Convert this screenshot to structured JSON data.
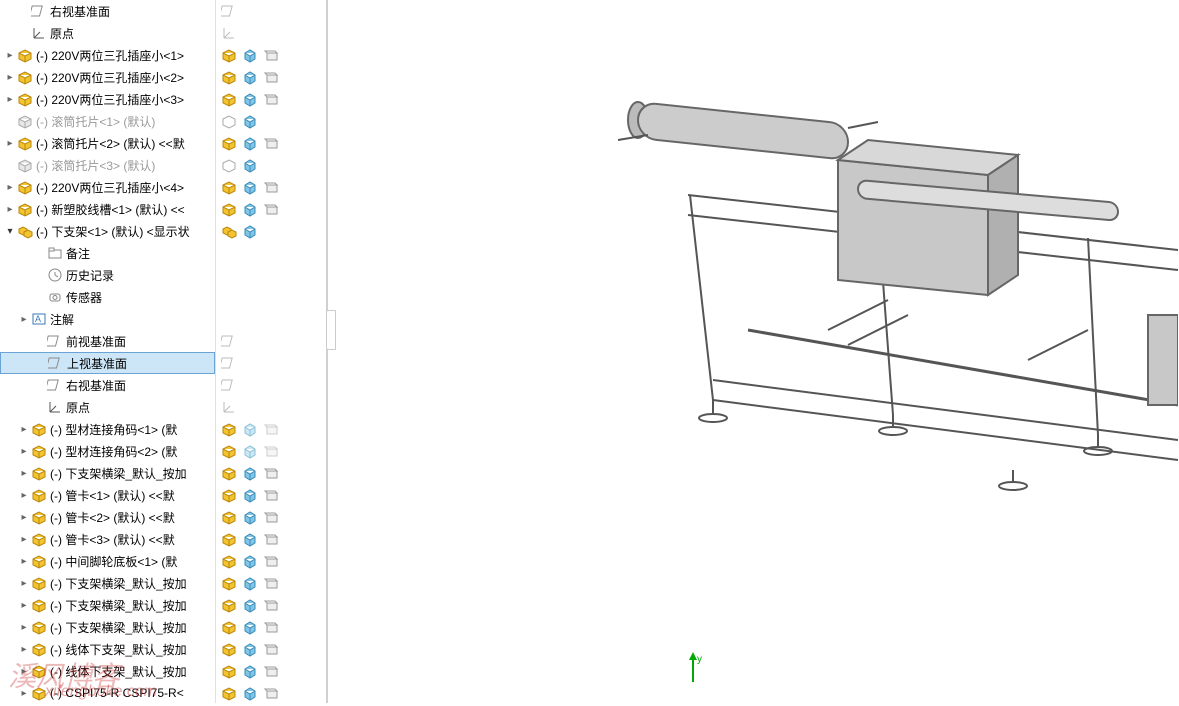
{
  "tree": {
    "items": [
      {
        "indent": 1,
        "arrow": "",
        "icon": "plane",
        "label": "右视基准面",
        "gray": false
      },
      {
        "indent": 1,
        "arrow": "",
        "icon": "origin",
        "label": "原点",
        "gray": false
      },
      {
        "indent": 0,
        "arrow": "r",
        "icon": "part",
        "label": "(-) 220V两位三孔插座小<1>",
        "gray": false
      },
      {
        "indent": 0,
        "arrow": "r",
        "icon": "part",
        "label": "(-) 220V两位三孔插座小<2>",
        "gray": false
      },
      {
        "indent": 0,
        "arrow": "r",
        "icon": "part",
        "label": "(-) 220V两位三孔插座小<3>",
        "gray": false
      },
      {
        "indent": 0,
        "arrow": "",
        "icon": "part-g",
        "label": "(-) 滚筒托片<1> (默认)",
        "gray": true
      },
      {
        "indent": 0,
        "arrow": "r",
        "icon": "part",
        "label": "(-) 滚筒托片<2> (默认) <<默",
        "gray": false
      },
      {
        "indent": 0,
        "arrow": "",
        "icon": "part-g",
        "label": "(-) 滚筒托片<3> (默认)",
        "gray": true
      },
      {
        "indent": 0,
        "arrow": "r",
        "icon": "part",
        "label": "(-) 220V两位三孔插座小<4>",
        "gray": false
      },
      {
        "indent": 0,
        "arrow": "r",
        "icon": "part",
        "label": "(-) 新塑胶线槽<1> (默认) <<",
        "gray": false
      },
      {
        "indent": 0,
        "arrow": "d",
        "icon": "asm",
        "label": "(-) 下支架<1> (默认) <显示状",
        "gray": false
      },
      {
        "indent": 2,
        "arrow": "",
        "icon": "folder",
        "label": "备注",
        "gray": false
      },
      {
        "indent": 2,
        "arrow": "",
        "icon": "history",
        "label": "历史记录",
        "gray": false
      },
      {
        "indent": 2,
        "arrow": "",
        "icon": "sensor",
        "label": "传感器",
        "gray": false
      },
      {
        "indent": 1,
        "arrow": "r",
        "icon": "annot",
        "label": "注解",
        "gray": false
      },
      {
        "indent": 2,
        "arrow": "",
        "icon": "plane",
        "label": "前视基准面",
        "gray": false
      },
      {
        "indent": 2,
        "arrow": "",
        "icon": "plane",
        "label": "上视基准面",
        "gray": false,
        "selected": true
      },
      {
        "indent": 2,
        "arrow": "",
        "icon": "plane",
        "label": "右视基准面",
        "gray": false
      },
      {
        "indent": 2,
        "arrow": "",
        "icon": "origin",
        "label": "原点",
        "gray": false
      },
      {
        "indent": 1,
        "arrow": "r",
        "icon": "part",
        "label": "(-) 型材连接角码<1> (默",
        "gray": false
      },
      {
        "indent": 1,
        "arrow": "r",
        "icon": "part",
        "label": "(-) 型材连接角码<2> (默",
        "gray": false
      },
      {
        "indent": 1,
        "arrow": "r",
        "icon": "part",
        "label": "(-) 下支架横梁_默认_按加",
        "gray": false
      },
      {
        "indent": 1,
        "arrow": "r",
        "icon": "part",
        "label": "(-) 管卡<1> (默认) <<默",
        "gray": false
      },
      {
        "indent": 1,
        "arrow": "r",
        "icon": "part",
        "label": "(-) 管卡<2> (默认) <<默",
        "gray": false
      },
      {
        "indent": 1,
        "arrow": "r",
        "icon": "part",
        "label": "(-) 管卡<3> (默认) <<默",
        "gray": false
      },
      {
        "indent": 1,
        "arrow": "r",
        "icon": "part",
        "label": "(-) 中间脚轮底板<1> (默",
        "gray": false
      },
      {
        "indent": 1,
        "arrow": "r",
        "icon": "part",
        "label": "(-) 下支架横梁_默认_按加",
        "gray": false
      },
      {
        "indent": 1,
        "arrow": "r",
        "icon": "part",
        "label": "(-) 下支架横梁_默认_按加",
        "gray": false
      },
      {
        "indent": 1,
        "arrow": "r",
        "icon": "part",
        "label": "(-) 下支架横梁_默认_按加",
        "gray": false
      },
      {
        "indent": 1,
        "arrow": "r",
        "icon": "part",
        "label": "(-) 线体下支架_默认_按加",
        "gray": false
      },
      {
        "indent": 1,
        "arrow": "r",
        "icon": "part",
        "label": "(-) 线体下支架_默认_按加",
        "gray": false
      },
      {
        "indent": 1,
        "arrow": "r",
        "icon": "part",
        "label": "(-) CSPI75-R CSPI75-R<",
        "gray": false
      }
    ]
  },
  "iconCol": {
    "rows": [
      [
        "plane-g"
      ],
      [
        "origin-g"
      ],
      [
        "part",
        "cube",
        "sheet"
      ],
      [
        "part",
        "cube",
        "sheet"
      ],
      [
        "part",
        "cube",
        "sheet"
      ],
      [
        "part-gl",
        "cube"
      ],
      [
        "part",
        "cube",
        "sheet"
      ],
      [
        "part-gl",
        "cube"
      ],
      [
        "part",
        "cube",
        "sheet"
      ],
      [
        "part",
        "cube",
        "sheet"
      ],
      [
        "asm",
        "cube"
      ],
      [],
      [],
      [],
      [],
      [
        "plane-g"
      ],
      [
        "plane-g"
      ],
      [
        "plane-g"
      ],
      [
        "origin-g"
      ],
      [
        "part",
        "cube-t",
        "sheet-t"
      ],
      [
        "part",
        "cube-t",
        "sheet-t"
      ],
      [
        "part",
        "cube",
        "sheet"
      ],
      [
        "part",
        "cube",
        "sheet"
      ],
      [
        "part",
        "cube",
        "sheet"
      ],
      [
        "part",
        "cube",
        "sheet"
      ],
      [
        "part",
        "cube",
        "sheet"
      ],
      [
        "part",
        "cube",
        "sheet"
      ],
      [
        "part",
        "cube",
        "sheet"
      ],
      [
        "part",
        "cube",
        "sheet"
      ],
      [
        "part",
        "cube",
        "sheet"
      ],
      [
        "part",
        "cube",
        "sheet"
      ],
      [
        "part",
        "cube",
        "sheet"
      ]
    ]
  },
  "watermark": {
    "main": "溪风博客",
    "sub": "xifengboke.com"
  },
  "axis": {
    "y": "y"
  }
}
